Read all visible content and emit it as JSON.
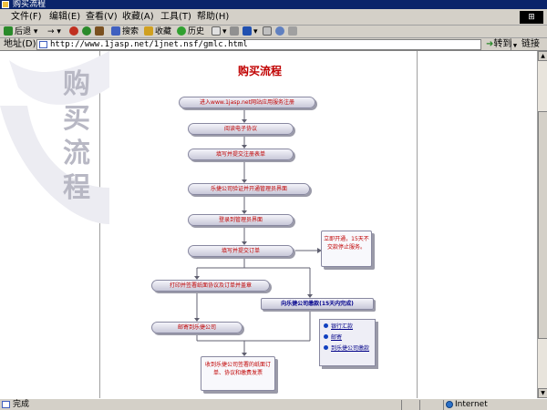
{
  "window": {
    "title": "购买流程"
  },
  "menu": {
    "items": [
      "文件(F)",
      "编辑(E)",
      "查看(V)",
      "收藏(A)",
      "工具(T)",
      "帮助(H)"
    ]
  },
  "toolbar": {
    "back": "后退",
    "search": "搜索",
    "favorites": "收藏",
    "history": "历史"
  },
  "address": {
    "label": "地址(D)",
    "url": "http://www.1jasp.net/1jnet.nsf/gmlc.html",
    "go": "转到",
    "links": "链接"
  },
  "page": {
    "side_title": "购买流程",
    "title": "购买流程",
    "steps": [
      "进入www.1jasp.net网站应用服务注册",
      "阅读电子协议",
      "填写并提交注册表单",
      "乐捷公司验证并开通管理员界面",
      "登录到管理员界面",
      "填写并提交订单",
      "打印并签署纸面协议及订单并盖章",
      "向乐捷公司缴款(15天内完成)",
      "邮寄到乐捷公司",
      "收到乐捷公司签署的纸面订单、协议和缴费发票"
    ],
    "note": "立即开通，15天不交款停止服务。",
    "payment_methods": [
      "银行汇款",
      "邮寄",
      "到乐捷公司缴款"
    ]
  },
  "status": {
    "text": "完成",
    "zone": "Internet"
  },
  "colors": {
    "accent_red": "#c00000",
    "link_blue": "#000088",
    "titlebar": "#0a246a"
  }
}
